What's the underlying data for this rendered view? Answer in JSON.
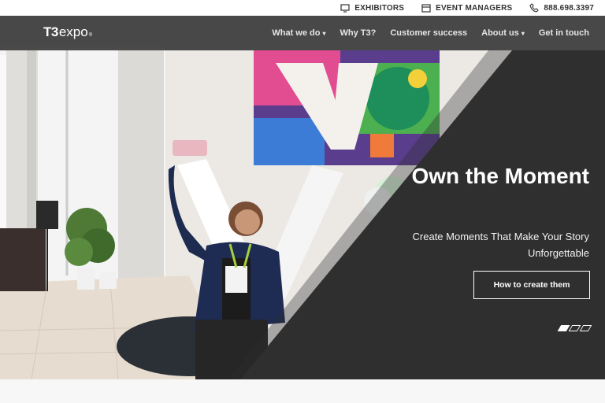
{
  "utility_bar": {
    "exhibitors_label": "EXHIBITORS",
    "event_managers_label": "EVENT MANAGERS",
    "phone": "888.698.3397"
  },
  "nav": {
    "logo_t3": "T3",
    "logo_expo": "expo",
    "logo_mark": "®",
    "links": [
      {
        "label": "What we do",
        "dropdown": true
      },
      {
        "label": "Why T3?",
        "dropdown": false
      },
      {
        "label": "Customer success",
        "dropdown": false
      },
      {
        "label": "About us",
        "dropdown": true
      },
      {
        "label": "Get in touch",
        "dropdown": false
      }
    ]
  },
  "hero": {
    "headline": "Own the Moment",
    "subhead": "Create Moments That Make Your Story Unforgettable",
    "cta_label": "How to create them",
    "slides_total": 3,
    "slide_active": 1
  },
  "colors": {
    "panel": "#2f2f2f",
    "nav_bg": "#2d2d2d",
    "accent_green": "#7dbb3f",
    "text_light": "#ffffff"
  },
  "icons": {
    "exhibitors": "monitor-icon",
    "event_managers": "calendar-icon",
    "phone": "phone-icon",
    "dropdown": "chevron-down-icon"
  }
}
